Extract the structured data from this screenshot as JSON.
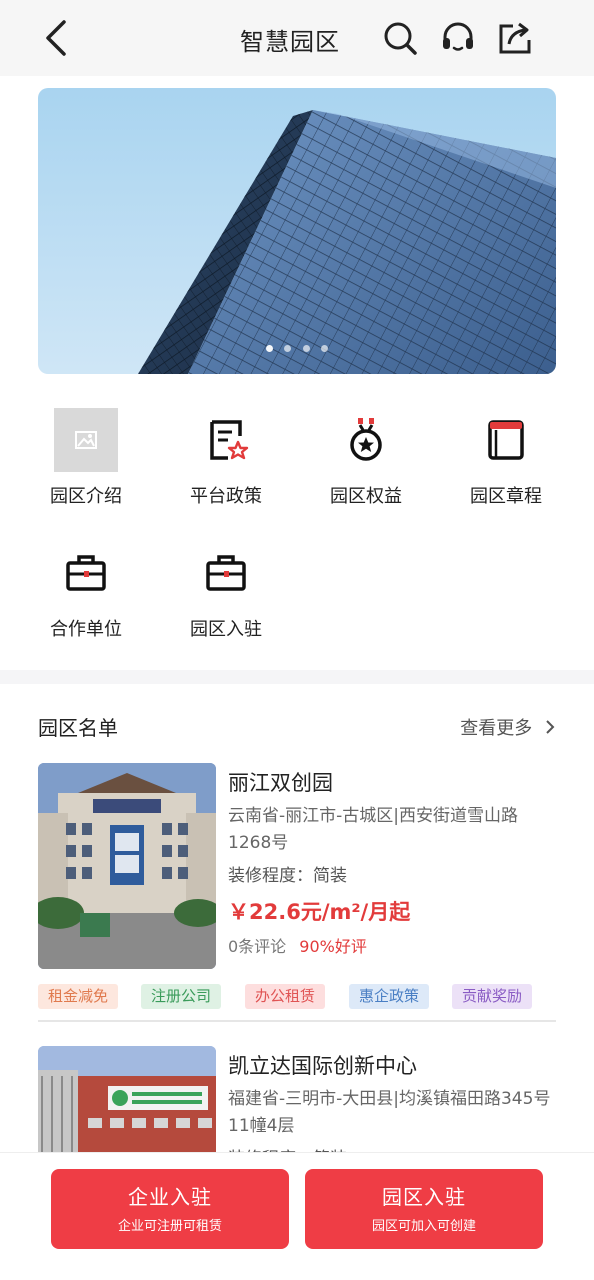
{
  "header": {
    "title": "智慧园区",
    "icons": [
      "back-arrow-icon",
      "search-icon",
      "headset-icon",
      "share-icon"
    ]
  },
  "banner": {
    "slide_count": 4,
    "active_index": 0
  },
  "menu": [
    {
      "label": "园区介绍",
      "icon": "image-placeholder-icon"
    },
    {
      "label": "平台政策",
      "icon": "policy-document-icon"
    },
    {
      "label": "园区权益",
      "icon": "medal-icon"
    },
    {
      "label": "园区章程",
      "icon": "book-icon"
    },
    {
      "label": "合作单位",
      "icon": "briefcase-icon"
    },
    {
      "label": "园区入驻",
      "icon": "briefcase-icon"
    }
  ],
  "park_list": {
    "title": "园区名单",
    "more_label": "查看更多",
    "items": [
      {
        "name": "丽江双创园",
        "address": "云南省-丽江市-古城区|西安街道雪山路1268号",
        "decoration": "装修程度：简装",
        "price": "￥22.6元/m²/月起",
        "reviews": "0条评论",
        "positive": "90%好评",
        "tags": [
          "租金减免",
          "注册公司",
          "办公租赁",
          "惠企政策",
          "贡献奖励"
        ]
      },
      {
        "name": "凯立达国际创新中心",
        "address": "福建省-三明市-大田县|均溪镇福田路345号11幢4层",
        "decoration": "装修程度：简装"
      }
    ]
  },
  "bottom_bar": {
    "left": {
      "title": "企业入驻",
      "subtitle": "企业可注册可租赁"
    },
    "right": {
      "title": "园区入驻",
      "subtitle": "园区可加入可创建"
    }
  },
  "colors": {
    "accent_red": "#ef3d45",
    "price_red": "#e23b3b",
    "tag_colors": [
      {
        "bg": "#fde7de",
        "fg": "#e07a4e"
      },
      {
        "bg": "#dff1e4",
        "fg": "#3a9b5a"
      },
      {
        "bg": "#fddede",
        "fg": "#e05454"
      },
      {
        "bg": "#dde9f8",
        "fg": "#4a7fc4"
      },
      {
        "bg": "#ece1f7",
        "fg": "#8a5cc4"
      }
    ]
  }
}
